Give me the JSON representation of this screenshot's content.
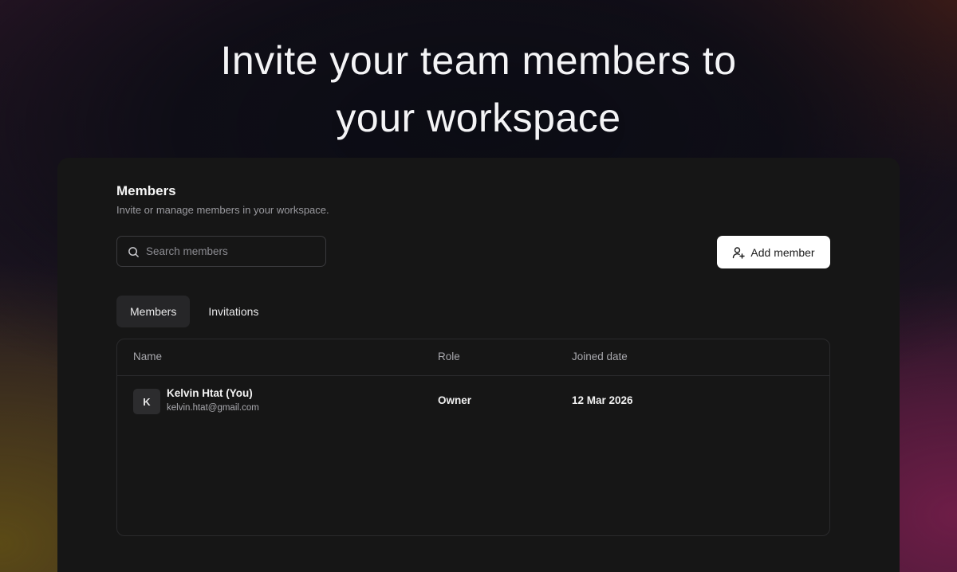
{
  "hero": {
    "line1": "Invite your team members to",
    "line2": "your workspace"
  },
  "panel": {
    "title": "Members",
    "subtitle": "Invite or manage members in your workspace."
  },
  "search": {
    "placeholder": "Search members",
    "value": "",
    "icon": "search-icon"
  },
  "add_button": {
    "label": "Add member",
    "icon": "user-plus-icon"
  },
  "tabs": [
    {
      "label": "Members",
      "active": true
    },
    {
      "label": "Invitations",
      "active": false
    }
  ],
  "table": {
    "columns": [
      "Name",
      "Role",
      "Joined date"
    ],
    "rows": [
      {
        "avatar_initial": "K",
        "name": "Kelvin Htat (You)",
        "email": "kelvin.htat@gmail.com",
        "role": "Owner",
        "joined": "12 Mar 2026"
      }
    ]
  },
  "colors": {
    "panel_bg": "#161616",
    "button_bg": "#ffffff",
    "active_tab_bg": "#262628"
  }
}
